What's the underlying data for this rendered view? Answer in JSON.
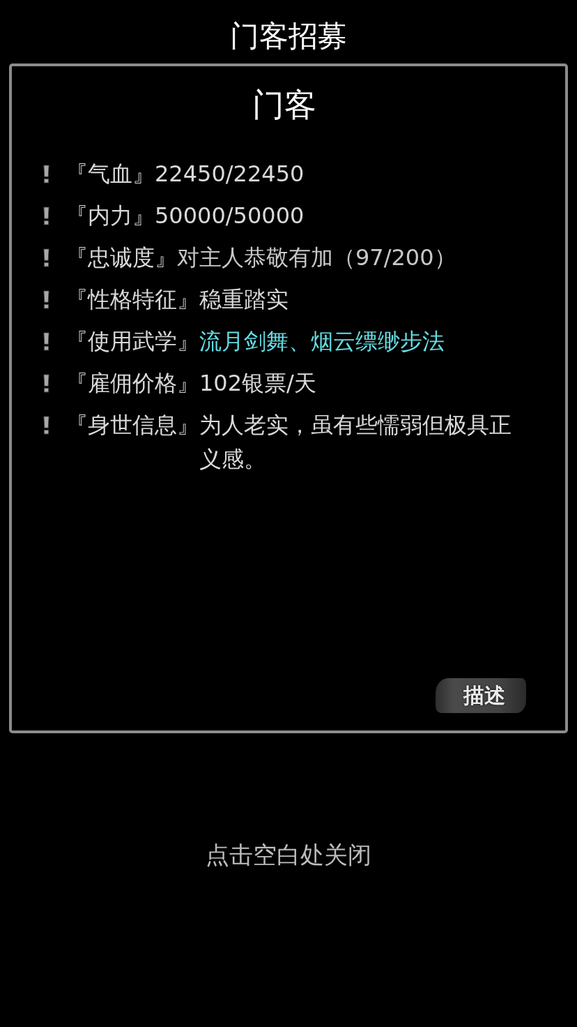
{
  "screen": {
    "title": "门客招募"
  },
  "dialog": {
    "title": "门客",
    "stats": [
      {
        "label": "『气血』",
        "value": "22450/22450",
        "color": "#d9d9d9"
      },
      {
        "label": "『内力』",
        "value": "50000/50000",
        "color": "#d9d9d9"
      },
      {
        "label": "『忠诚度』",
        "value": "对主人恭敬有加（97/200）",
        "color": "#c8c8c8"
      },
      {
        "label": "『性格特征』",
        "value": "稳重踏实",
        "color": "#d9d9d9"
      },
      {
        "label": "『使用武学』",
        "value": "流月剑舞、烟云缥缈步法",
        "color": "#66dce4"
      },
      {
        "label": "『雇佣价格』",
        "value": "102银票/天",
        "color": "#d9d9d9"
      },
      {
        "label": "『身世信息』",
        "value": "为人老实，虽有些懦弱但极具正义感。",
        "color": "#d9d9d9"
      }
    ],
    "describe_button": "描述"
  },
  "close_hint": "点击空白处关闭"
}
